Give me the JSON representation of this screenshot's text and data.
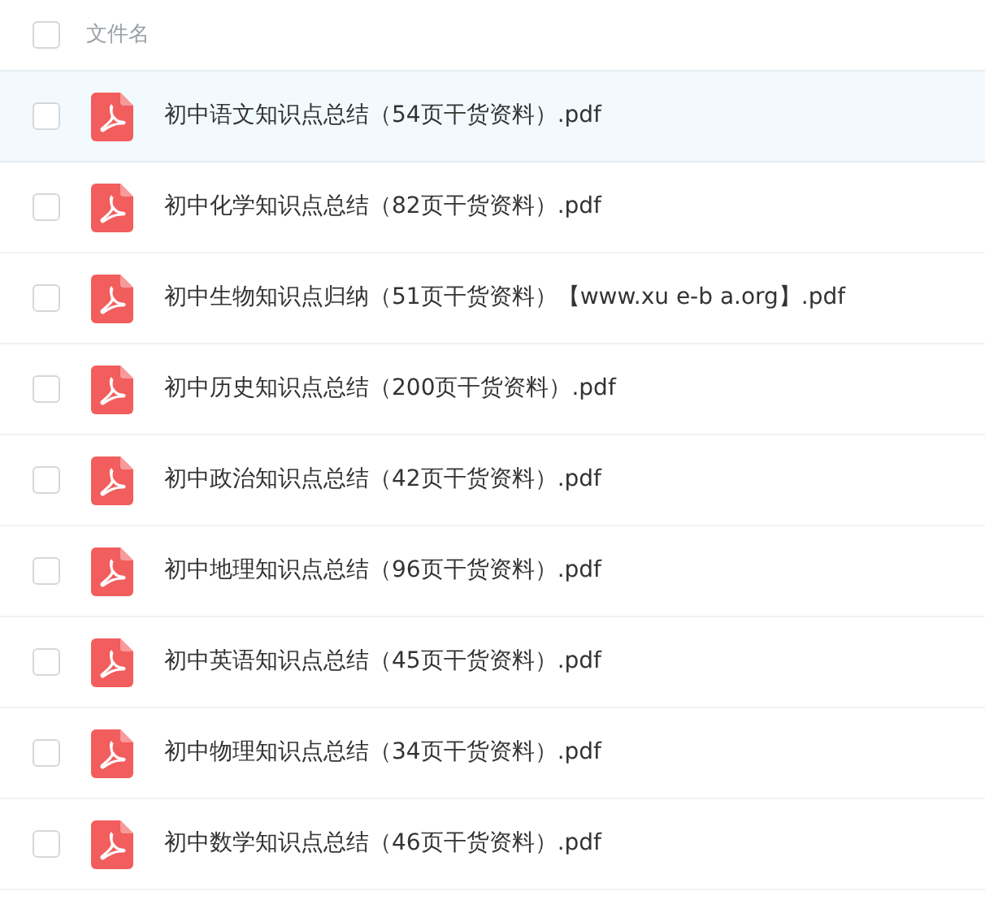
{
  "header": {
    "checked": false,
    "label": "文件名"
  },
  "files": [
    {
      "name": "初中语文知识点总结（54页干货资料）.pdf",
      "selected": true,
      "checked": false
    },
    {
      "name": "初中化学知识点总结（82页干货资料）.pdf",
      "selected": false,
      "checked": false
    },
    {
      "name": "初中生物知识点归纳（51页干货资料）【www.xu e-b a.org】.pdf",
      "selected": false,
      "checked": false
    },
    {
      "name": "初中历史知识点总结（200页干货资料）.pdf",
      "selected": false,
      "checked": false
    },
    {
      "name": "初中政治知识点总结（42页干货资料）.pdf",
      "selected": false,
      "checked": false
    },
    {
      "name": "初中地理知识点总结（96页干货资料）.pdf",
      "selected": false,
      "checked": false
    },
    {
      "name": "初中英语知识点总结（45页干货资料）.pdf",
      "selected": false,
      "checked": false
    },
    {
      "name": "初中物理知识点总结（34页干货资料）.pdf",
      "selected": false,
      "checked": false
    },
    {
      "name": "初中数学知识点总结（46页干货资料）.pdf",
      "selected": false,
      "checked": false
    }
  ]
}
